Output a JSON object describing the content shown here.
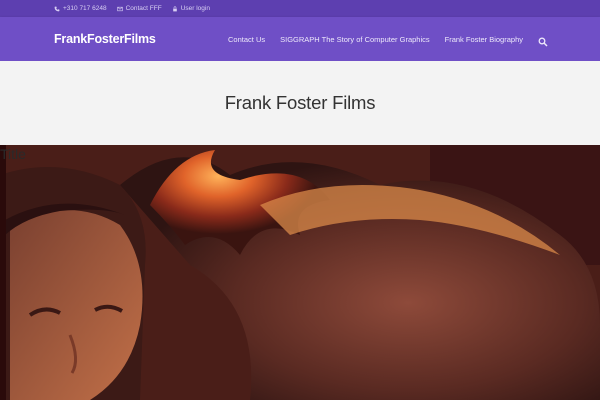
{
  "topbar": {
    "phone": "+310 717 6248",
    "contact": "Contact FFF",
    "login": "User login"
  },
  "header": {
    "logo": "FrankFosterFilms",
    "nav": [
      {
        "label": "Contact Us"
      },
      {
        "label": "SIGGRAPH The Story of Computer Graphics"
      },
      {
        "label": "Frank Foster Biography"
      }
    ]
  },
  "hero": {
    "title": "Frank Foster Films"
  },
  "photo": {
    "alt_text": "Title"
  },
  "colors": {
    "topbar_bg": "#5d3fb0",
    "header_bg": "#6f4fc6",
    "hero_bg": "#f3f3f3"
  }
}
